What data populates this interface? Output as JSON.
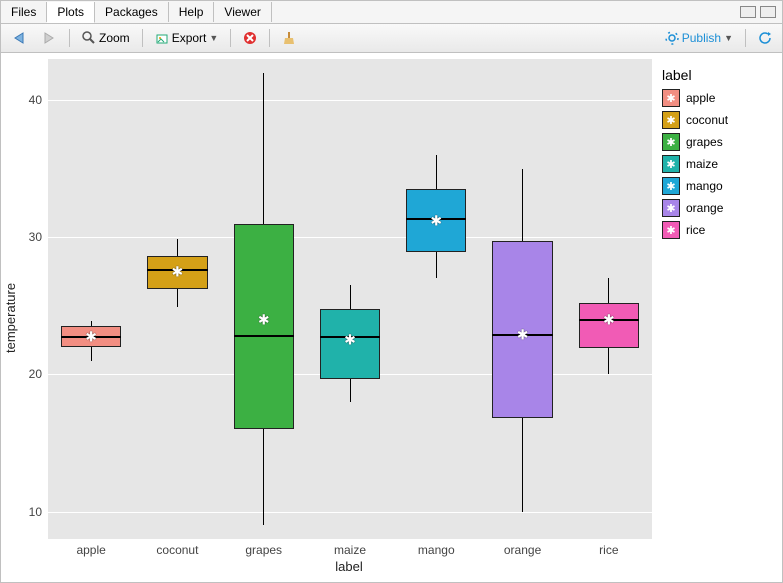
{
  "tabs": {
    "files": "Files",
    "plots": "Plots",
    "packages": "Packages",
    "help": "Help",
    "viewer": "Viewer",
    "active": "Plots"
  },
  "toolbar": {
    "zoom": "Zoom",
    "export": "Export",
    "publish": "Publish"
  },
  "legend": {
    "title": "label",
    "items": [
      {
        "label": "apple",
        "color": "#f28e82"
      },
      {
        "label": "coconut",
        "color": "#d4a017"
      },
      {
        "label": "grapes",
        "color": "#3cb043"
      },
      {
        "label": "maize",
        "color": "#20b2aa"
      },
      {
        "label": "mango",
        "color": "#1fa7d6"
      },
      {
        "label": "orange",
        "color": "#a885e8"
      },
      {
        "label": "rice",
        "color": "#f15bb5"
      }
    ]
  },
  "axes": {
    "xlabel": "label",
    "ylabel": "temperature"
  },
  "chart_data": {
    "type": "boxplot",
    "xlabel": "label",
    "ylabel": "temperature",
    "ylim": [
      8,
      43
    ],
    "yticks": [
      10,
      20,
      30,
      40
    ],
    "categories": [
      "apple",
      "coconut",
      "grapes",
      "maize",
      "mango",
      "orange",
      "rice"
    ],
    "series": [
      {
        "name": "apple",
        "color": "#f28e82",
        "min": 21.0,
        "q1": 22.0,
        "median": 22.7,
        "q3": 23.5,
        "max": 23.9,
        "mean": 22.7
      },
      {
        "name": "coconut",
        "color": "#d4a017",
        "min": 24.9,
        "q1": 26.2,
        "median": 27.6,
        "q3": 28.6,
        "max": 29.9,
        "mean": 27.5
      },
      {
        "name": "grapes",
        "color": "#3cb043",
        "min": 9.0,
        "q1": 16.0,
        "median": 22.8,
        "q3": 31.0,
        "max": 42.0,
        "mean": 24.0
      },
      {
        "name": "maize",
        "color": "#20b2aa",
        "min": 18.0,
        "q1": 19.7,
        "median": 22.7,
        "q3": 24.8,
        "max": 26.5,
        "mean": 22.5
      },
      {
        "name": "mango",
        "color": "#1fa7d6",
        "min": 27.0,
        "q1": 28.9,
        "median": 31.3,
        "q3": 33.5,
        "max": 36.0,
        "mean": 31.2
      },
      {
        "name": "orange",
        "color": "#a885e8",
        "min": 10.0,
        "q1": 16.8,
        "median": 22.9,
        "q3": 29.7,
        "max": 35.0,
        "mean": 22.9
      },
      {
        "name": "rice",
        "color": "#f15bb5",
        "min": 20.0,
        "q1": 21.9,
        "median": 24.0,
        "q3": 25.2,
        "max": 27.0,
        "mean": 24.0
      }
    ]
  }
}
